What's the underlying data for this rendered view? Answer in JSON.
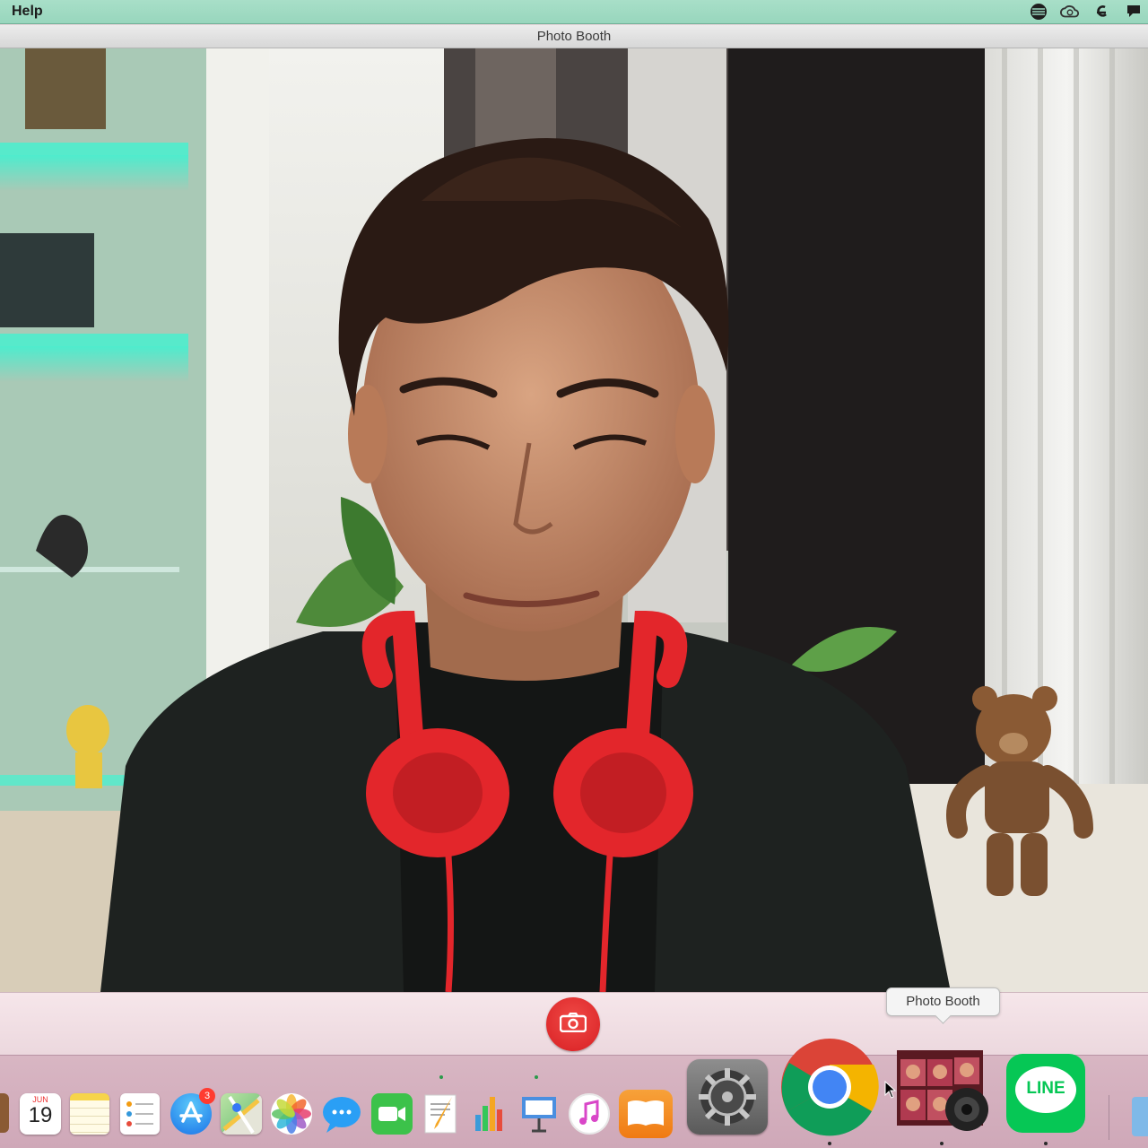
{
  "menubar": {
    "menu_help": "Help",
    "status_icons": [
      "vpn-icon",
      "creative-cloud-icon",
      "evernote-icon",
      "chat-icon"
    ]
  },
  "window": {
    "title": "Photo Booth"
  },
  "toolbar": {
    "shutter_icon": "camera-icon",
    "shutter_color": "#e02a2a"
  },
  "dock": {
    "tooltip": "Photo Booth",
    "calendar": {
      "month": "JUN",
      "day": "19"
    },
    "app_store_badge": "3",
    "line_label": "LINE",
    "apps": [
      "Calendar",
      "Notes",
      "Reminders",
      "App Store",
      "Maps",
      "Photos",
      "Messages",
      "FaceTime",
      "Pages",
      "Numbers",
      "Keynote",
      "iTunes",
      "iBooks",
      "System Preferences",
      "Google Chrome",
      "Photo Booth",
      "LINE"
    ]
  }
}
